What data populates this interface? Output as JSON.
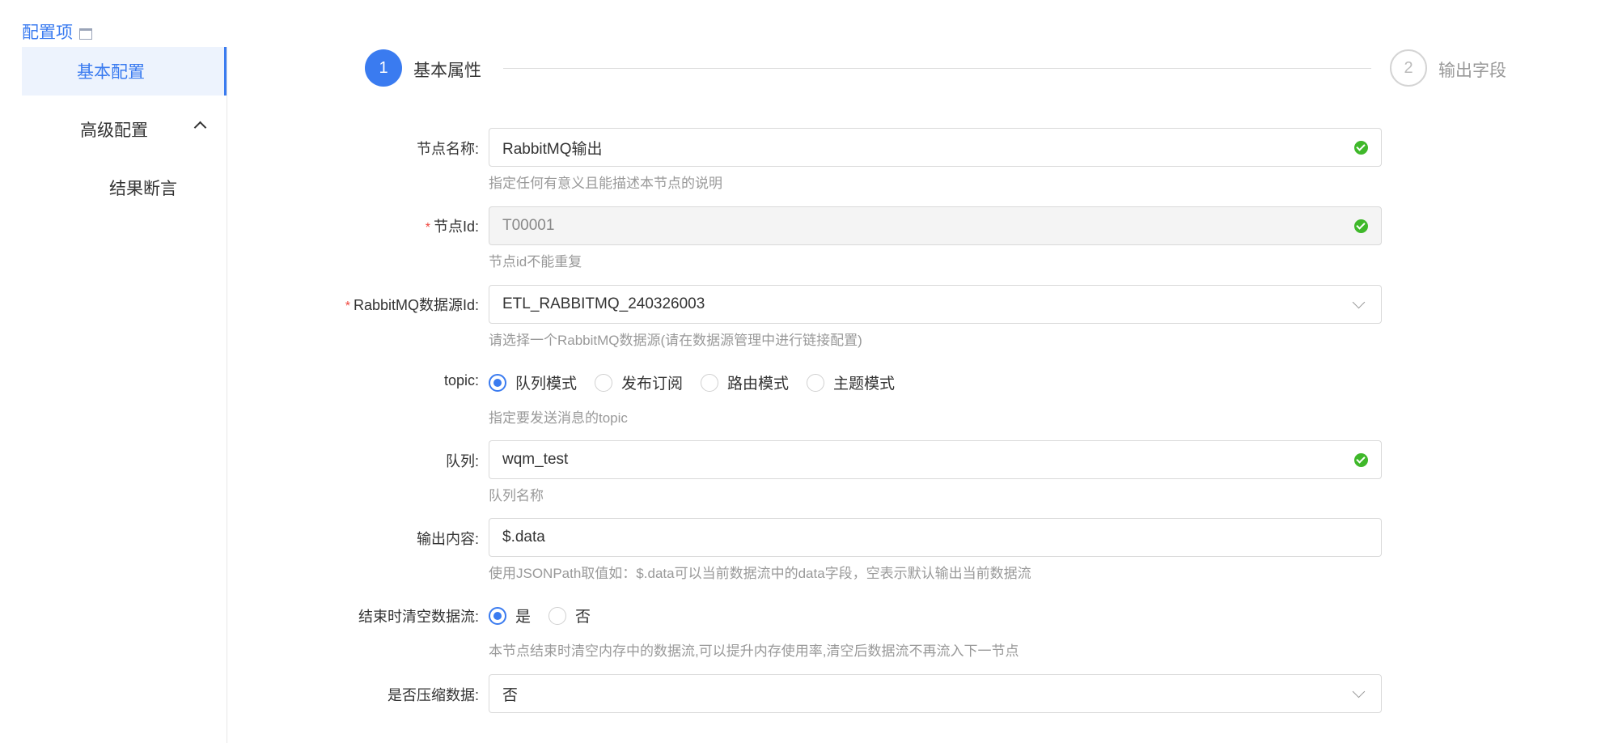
{
  "sidebar": {
    "title": "配置项",
    "items": [
      {
        "label": "基本配置"
      },
      {
        "label": "高级配置"
      },
      {
        "label": "结果断言"
      }
    ]
  },
  "steps": [
    {
      "number": "1",
      "label": "基本属性"
    },
    {
      "number": "2",
      "label": "输出字段"
    }
  ],
  "form": {
    "node_name": {
      "label": "节点名称:",
      "value": "RabbitMQ输出",
      "help": "指定任何有意义且能描述本节点的说明"
    },
    "node_id": {
      "required_mark": "*",
      "label": "节点Id:",
      "value": "T00001",
      "help": "节点id不能重复"
    },
    "datasource": {
      "required_mark": "*",
      "label": "RabbitMQ数据源Id:",
      "value": "ETL_RABBITMQ_240326003",
      "help": "请选择一个RabbitMQ数据源(请在数据源管理中进行链接配置)"
    },
    "topic": {
      "label": "topic:",
      "options": [
        "队列模式",
        "发布订阅",
        "路由模式",
        "主题模式"
      ],
      "selected": "队列模式",
      "help": "指定要发送消息的topic"
    },
    "queue": {
      "label": "队列:",
      "value": "wqm_test",
      "help": "队列名称"
    },
    "output": {
      "label": "输出内容:",
      "value": "$.data",
      "help": "使用JSONPath取值如：$.data可以当前数据流中的data字段，空表示默认输出当前数据流"
    },
    "clear": {
      "label": "结束时清空数据流:",
      "options": [
        "是",
        "否"
      ],
      "selected": "是",
      "help": "本节点结束时清空内存中的数据流,可以提升内存使用率,清空后数据流不再流入下一节点"
    },
    "compress": {
      "label": "是否压缩数据:",
      "value": "否"
    }
  }
}
